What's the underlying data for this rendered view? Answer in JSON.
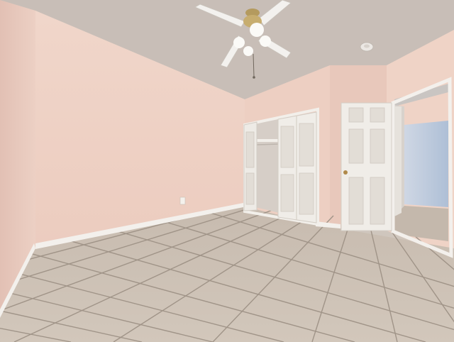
{
  "photo": {
    "subject": "empty-bedroom-interior",
    "colors": {
      "ceiling": "#c9bfb8",
      "wall_left": "#e9cabe",
      "wall_back": "#efd2c6",
      "wall_right": "#edd1c4",
      "baseboard": "#f2efea",
      "tile": "#cbbfb2",
      "grout": "#9e9286",
      "door": "#eeebe6",
      "door_panel": "#e1ddd6",
      "hallway_wall": "#bcc9dc",
      "closet_interior": "#d3cbc4"
    },
    "icons": [
      "ceiling-fan-icon",
      "smoke-detector-icon",
      "door-knob-icon",
      "outlet-icon"
    ]
  }
}
